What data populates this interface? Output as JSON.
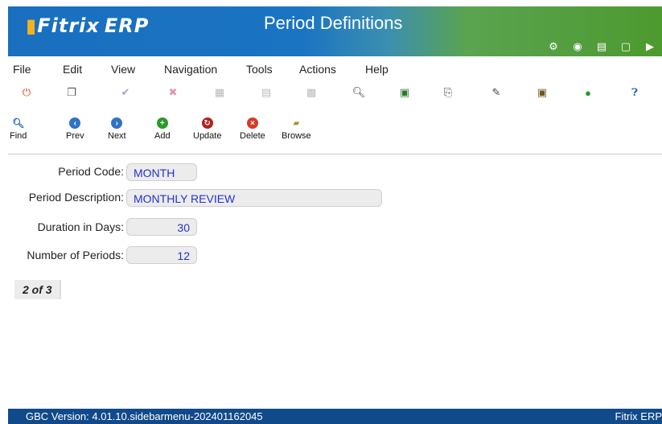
{
  "header": {
    "logo": "Fitrix",
    "logo_suffix": "ERP",
    "title": "Period Definitions",
    "icons": [
      "gear-icon",
      "globe-icon",
      "document-icon",
      "page-icon",
      "play-icon"
    ]
  },
  "menu": [
    "File",
    "Edit",
    "View",
    "Navigation",
    "Tools",
    "Actions",
    "Help"
  ],
  "toolbar_buttons": {
    "find": "Find",
    "prev": "Prev",
    "next": "Next",
    "add": "Add",
    "update": "Update",
    "delete": "Delete",
    "browse": "Browse"
  },
  "form": {
    "period_code_label": "Period Code:",
    "period_code": "MONTH",
    "period_description_label": "Period Description:",
    "period_description": "MONTHLY REVIEW",
    "duration_label": "Duration in Days:",
    "duration": "30",
    "num_periods_label": "Number of Periods:",
    "num_periods": "12"
  },
  "record_counter": "2 of 3",
  "status": {
    "version": "GBC Version: 4.01.10.sidebarmenu-202401162045",
    "brand": "Fitrix ERP"
  },
  "colors": {
    "header_blue": "#1a6fbf",
    "header_green": "#4d9a2f",
    "status_bar": "#114a8a",
    "field_text": "#2233cc"
  }
}
